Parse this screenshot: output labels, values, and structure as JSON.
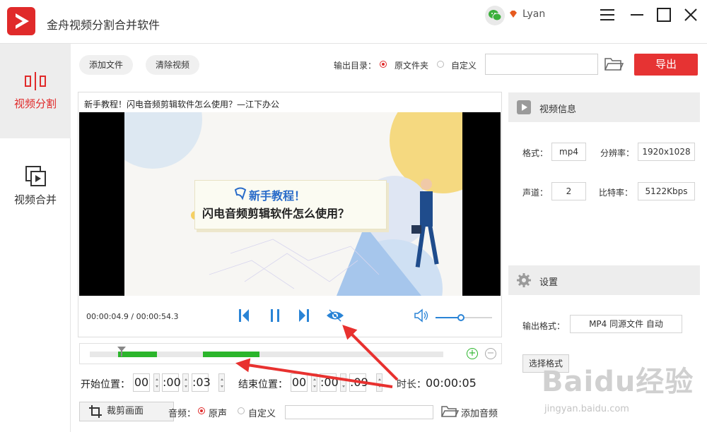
{
  "app": {
    "title": "金舟视频分割合并软件",
    "username": "Lyan"
  },
  "icons": {
    "logo": "play-logo-icon",
    "wechat": "wechat-icon",
    "vip": "vip-diamond-icon",
    "menu": "hamburger-menu-icon",
    "minimize": "minimize-icon",
    "maximize": "maximize-icon",
    "close": "close-icon",
    "split": "split-icon",
    "merge": "merge-icon",
    "folder": "folder-icon",
    "video_info": "video-info-icon",
    "settings": "gear-icon",
    "prev": "prev-frame-icon",
    "pause": "pause-icon",
    "next": "next-frame-icon",
    "preview": "eye-icon",
    "volume": "speaker-icon",
    "zoom_in": "plus-circle-icon",
    "zoom_out": "minus-circle-icon",
    "crop": "crop-icon"
  },
  "colors": {
    "accent": "#e02a2a",
    "export": "#e63333",
    "segment": "#2bb52b",
    "player_blue": "#2a84d6",
    "annotation": "#e8312f"
  },
  "sidebar": {
    "items": [
      {
        "label": "视频分割",
        "active": true
      },
      {
        "label": "视频合并",
        "active": false
      }
    ]
  },
  "toolbar": {
    "add_file": "添加文件",
    "clear_video": "清除视频",
    "output_dir_label": "输出目录：",
    "option_source": "原文件夹",
    "option_custom": "自定义",
    "selected_option": "原文件夹",
    "output_path": "",
    "export_label": "导出"
  },
  "player": {
    "video_title": "新手教程！闪电音频剪辑软件怎么使用？—江下办公",
    "overlay_line1": "新手教程！",
    "overlay_line2": "闪电音频剪辑软件怎么使用？",
    "time_readout": "00:00:04.9 / 00:00:54.3",
    "volume_percent": 45
  },
  "video_info": {
    "heading": "视频信息",
    "format_label": "格式：",
    "format_value": "mp4",
    "resolution_label": "分辨率：",
    "resolution_value": "1920x1028",
    "channels_label": "声道：",
    "channels_value": "2",
    "bitrate_label": "比特率：",
    "bitrate_value": "5122Kbps"
  },
  "settings": {
    "heading": "设置",
    "output_format_label": "输出格式：",
    "output_format_value": "MP4 同源文件 自动",
    "choose_format": "选择格式"
  },
  "timeline": {
    "playhead_fraction": 0.09,
    "segments": [
      {
        "start_fraction": 0.08,
        "end_fraction": 0.19
      },
      {
        "start_fraction": 0.32,
        "end_fraction": 0.48
      }
    ]
  },
  "cut": {
    "start_label": "开始位置：",
    "start": {
      "h": "00",
      "m": ":00",
      "s": ":03"
    },
    "end_label": "结束位置：",
    "end": {
      "h": "00",
      "m": ":00",
      "s": ":09"
    },
    "duration_label": "时长：",
    "duration_value": "00:00:05"
  },
  "bottom": {
    "crop_label": "裁剪画面",
    "audio_label": "音频：",
    "audio_original": "原声",
    "audio_custom": "自定义",
    "audio_path": "",
    "add_audio": "添加音频"
  },
  "watermark": {
    "big": "Baidu经验",
    "small": "jingyan.baidu.com"
  }
}
